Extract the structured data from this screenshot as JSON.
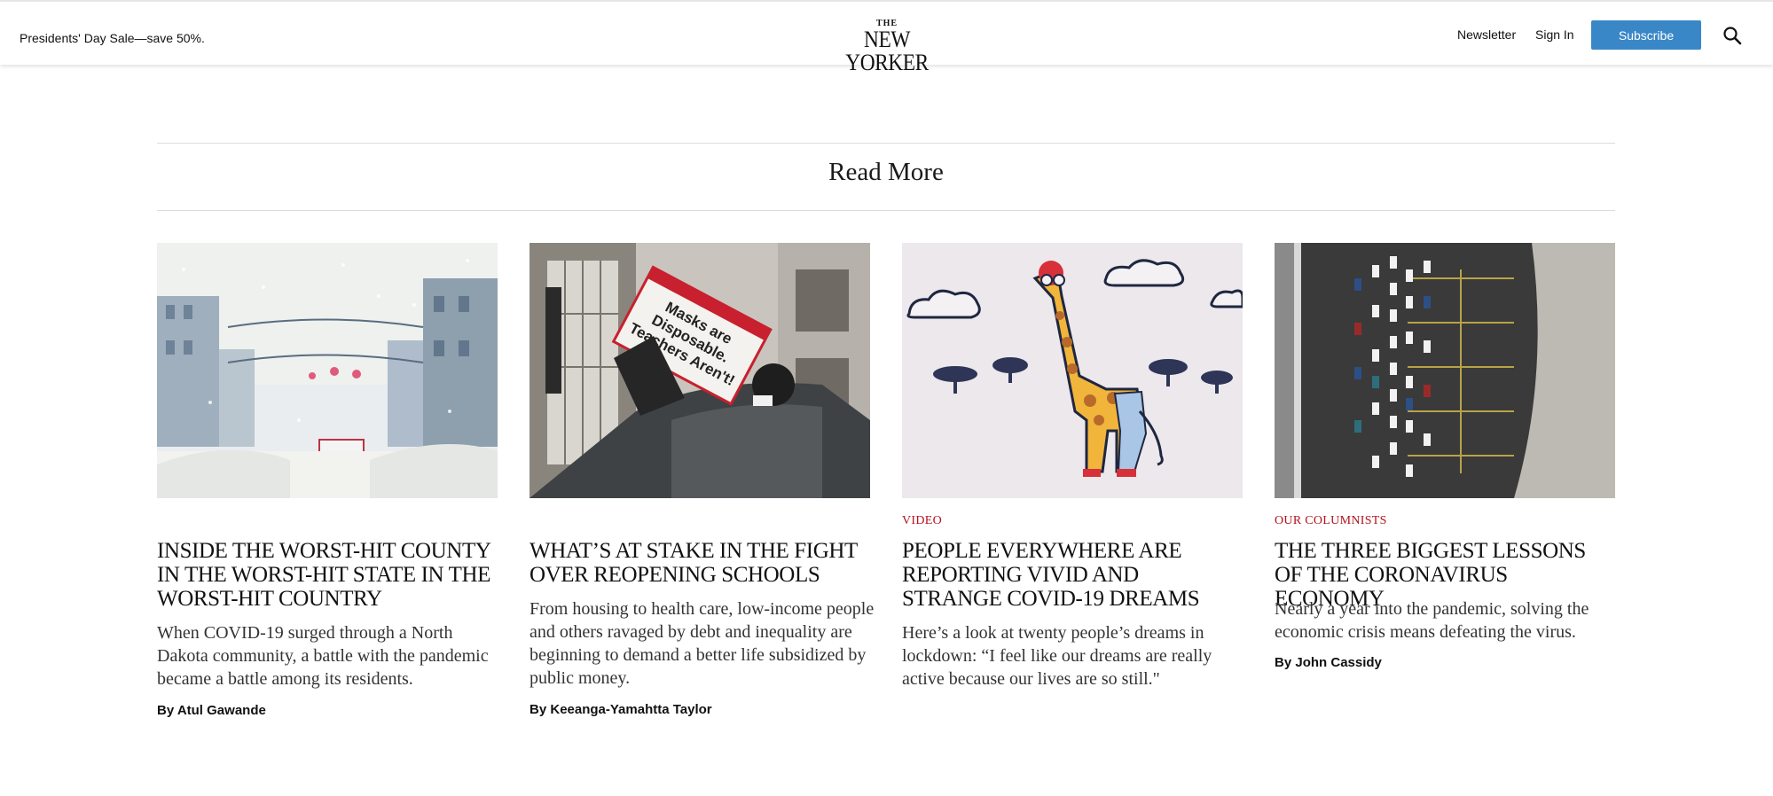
{
  "header": {
    "promo": "Presidents' Day Sale—save 50%.",
    "logo_the": "THE",
    "logo_name": "NEW YORKER",
    "newsletter": "Newsletter",
    "sign_in": "Sign In",
    "subscribe": "Subscribe",
    "search_icon": "search-icon"
  },
  "section": {
    "title": "Read More"
  },
  "cards": [
    {
      "rubric": "",
      "headline": "Inside the Worst-Hit County in the Worst-Hit State in the Worst-Hit Country",
      "dek": "When COVID-19 surged through a North Dakota community, a battle with the pandemic became a battle among its residents.",
      "by": "By",
      "author": "Atul Gawande"
    },
    {
      "rubric": "",
      "headline": "What’s at Stake in the Fight Over Reopening Schools",
      "dek": "From housing to health care, low-income people and others ravaged by debt and inequality are beginning to demand a better life subsidized by public money.",
      "by": "By",
      "author": "Keeanga-Yamahtta Taylor",
      "sign_text": "Masks are Disposable. Teachers Aren't!"
    },
    {
      "rubric": "Video",
      "headline": "People Everywhere Are Reporting Vivid and Strange COVID-19 Dreams",
      "dek": "Here’s a look at twenty people’s dreams in lockdown: “I feel like our dreams are really active because our lives are so still.\"",
      "by": "",
      "author": ""
    },
    {
      "rubric": "Our Columnists",
      "headline": "The Three Biggest Lessons of the Coronavirus Economy",
      "dek": "Nearly a year into the pandemic, solving the economic crisis means defeating the virus.",
      "by": "By",
      "author": "John Cassidy"
    }
  ],
  "colors": {
    "accent": "#3a87c7",
    "rubric": "#b3121c"
  }
}
